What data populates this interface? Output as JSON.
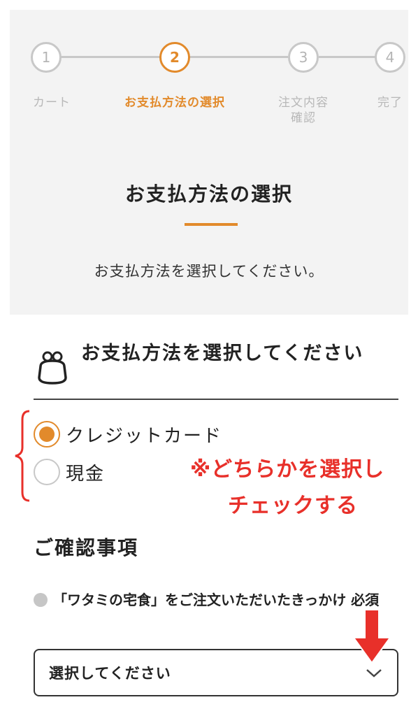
{
  "stepper": {
    "steps": [
      {
        "number": "1",
        "label": "カート"
      },
      {
        "number": "2",
        "label": "お支払方法の選択"
      },
      {
        "number": "3",
        "label": "注文内容\n確認"
      },
      {
        "number": "4",
        "label": "完了"
      }
    ],
    "active_step": 2
  },
  "header": {
    "title": "お支払方法の選択",
    "subtitle": "お支払方法を選択してください。"
  },
  "payment": {
    "icon": "purse-icon",
    "heading": "お支払方法を選択してください",
    "options": [
      {
        "label": "クレジットカード",
        "checked": true
      },
      {
        "label": "現金",
        "checked": false
      }
    ]
  },
  "annotation": {
    "line1": "※どちらかを選択し",
    "line2": "チェックする"
  },
  "confirmation": {
    "heading": "ご確認事項",
    "question": "「ワタミの宅食」をご注文いただいたきっかけ 必須",
    "select_value": "選択してください"
  },
  "colors": {
    "accent": "#e28a2b",
    "annotation_red": "#e8302a",
    "inactive_gray": "#c8c8c8"
  }
}
